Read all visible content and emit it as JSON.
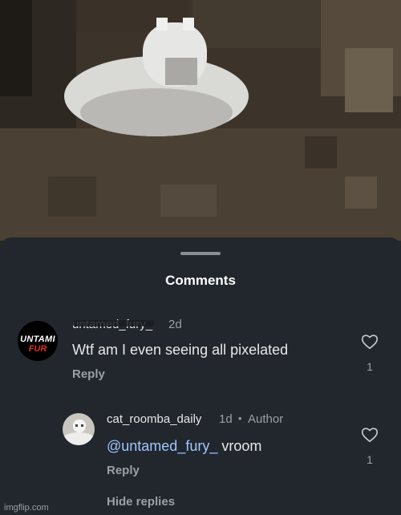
{
  "sheet": {
    "title": "Comments"
  },
  "comments": [
    {
      "username": "untamed_fury_",
      "time": "2d",
      "text": "Wtf am I even seeing all pixelated",
      "reply_label": "Reply",
      "likes": "1",
      "avatar": {
        "line1": "UNTAMI",
        "line2": "FUR"
      }
    }
  ],
  "reply": {
    "username": "cat_roomba_daily",
    "time": "1d",
    "separator": "•",
    "badge": "Author",
    "mention": "@untamed_fury_",
    "text": " vroom",
    "reply_label": "Reply",
    "likes": "1"
  },
  "hide_replies": "Hide replies",
  "watermark": "imgflip.com",
  "colors": {
    "sheet": "#22262d",
    "mention": "#9ec7ff",
    "muted": "#9aa0a6"
  }
}
